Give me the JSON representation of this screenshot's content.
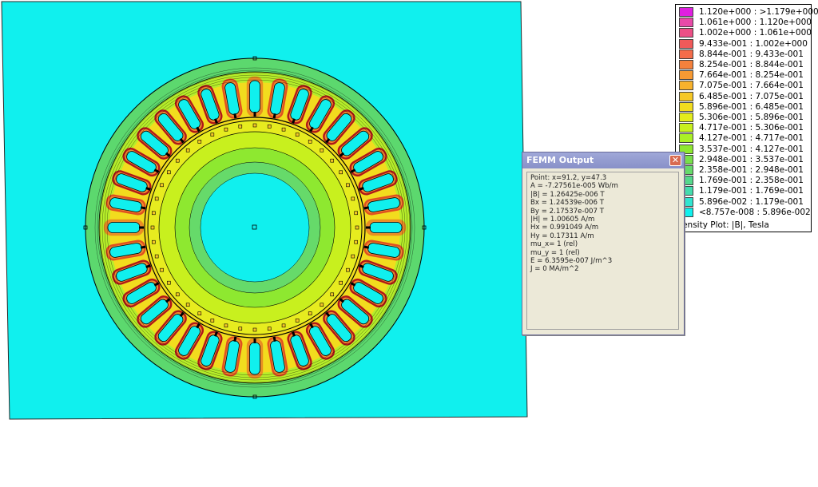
{
  "legend": {
    "rows": [
      {
        "label": "1.120e+000 : >1.179e+000",
        "color": "#e020e0"
      },
      {
        "label": "1.061e+000 : 1.120e+000",
        "color": "#e84aa8"
      },
      {
        "label": "1.002e+000 : 1.061e+000",
        "color": "#ec4f86"
      },
      {
        "label": "9.433e-001 : 1.002e+000",
        "color": "#f05a5a"
      },
      {
        "label": "8.844e-001 : 9.433e-001",
        "color": "#f46c4a"
      },
      {
        "label": "8.254e-001 : 8.844e-001",
        "color": "#f5813c"
      },
      {
        "label": "7.664e-001 : 8.254e-001",
        "color": "#f79a33"
      },
      {
        "label": "7.075e-001 : 7.664e-001",
        "color": "#f8b22c"
      },
      {
        "label": "6.485e-001 : 7.075e-001",
        "color": "#f6c825"
      },
      {
        "label": "5.896e-001 : 6.485e-001",
        "color": "#f2dc1e"
      },
      {
        "label": "5.306e-001 : 5.896e-001",
        "color": "#e3ec1c"
      },
      {
        "label": "4.717e-001 : 5.306e-001",
        "color": "#c8f01e"
      },
      {
        "label": "4.127e-001 : 4.717e-001",
        "color": "#aaf026"
      },
      {
        "label": "3.537e-001 : 4.127e-001",
        "color": "#8ee830"
      },
      {
        "label": "2.948e-001 : 3.537e-001",
        "color": "#78e04a"
      },
      {
        "label": "2.358e-001 : 2.948e-001",
        "color": "#66da6a"
      },
      {
        "label": "1.769e-001 : 2.358e-001",
        "color": "#55d88c"
      },
      {
        "label": "1.179e-001 : 1.769e-001",
        "color": "#44dcae"
      },
      {
        "label": "5.896e-002 : 1.179e-001",
        "color": "#30e4d0"
      },
      {
        "label": "<8.757e-008 : 5.896e-002",
        "color": "#10f0ee"
      }
    ],
    "caption": "Density Plot: |B|, Tesla"
  },
  "femm_output": {
    "title": "FEMM Output",
    "close_label": "✕",
    "lines": [
      "Point: x=91.2, y=47.3",
      "A  = -7.27561e-005 Wb/m",
      "|B| = 1.26425e-006 T",
      "Bx  = 1.24539e-006 T",
      "By  = 2.17537e-007 T",
      "|H| = 1.00605 A/m",
      "Hx  = 0.991049 A/m",
      "Hy  = 0.17311 A/m",
      "mu_x= 1 (rel)",
      "mu_y = 1 (rel)",
      "E  = 6.3595e-007 J/m^3",
      "J  = 0 MA/m^2"
    ]
  },
  "colors": {
    "air": "#10f0ee",
    "stator_outer": "#5cd86e",
    "stator_mid": "#b6ee2a",
    "tooth": "#f2dc1e",
    "slot": "#10f0ee",
    "rotor": "#e7ec1f",
    "rotor_inner": "#66da6a"
  }
}
